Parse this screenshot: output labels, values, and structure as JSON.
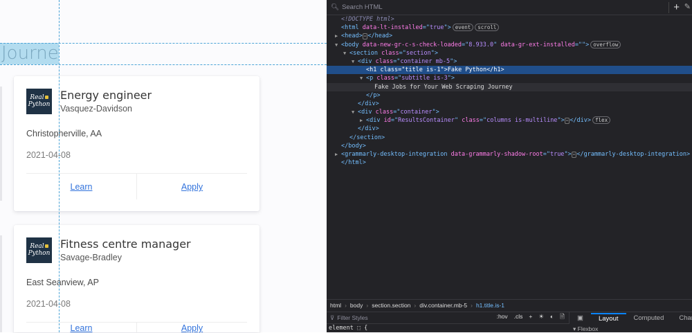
{
  "page": {
    "title_fragment": "Journey",
    "cards": [
      {
        "title": "Energy engineer",
        "company": "Vasquez-Davidson",
        "location": "Christopherville, AA",
        "date": "2021-04-08",
        "learn": "Learn",
        "apply": "Apply",
        "logo_text": "Real Python"
      },
      {
        "title": "Fitness centre manager",
        "company": "Savage-Bradley",
        "location": "East Seanview, AP",
        "date": "2021-04-08",
        "learn": "Learn",
        "apply": "Apply",
        "logo_text": "Real Python"
      }
    ]
  },
  "devtools": {
    "search_placeholder": "Search HTML",
    "lines": [
      {
        "ind": 1,
        "tw": "",
        "tokens": [
          {
            "t": "<!DOCTYPE html>",
            "c": "dt"
          }
        ]
      },
      {
        "ind": 1,
        "tw": "",
        "tokens": [
          {
            "t": "<html ",
            "c": "tg"
          },
          {
            "t": "data-lt-installed",
            "c": "at"
          },
          {
            "t": "=\"",
            "c": "tg"
          },
          {
            "t": "true",
            "c": "av"
          },
          {
            "t": "\">",
            "c": "tg"
          }
        ],
        "badges": [
          "event",
          "scroll"
        ]
      },
      {
        "ind": 1,
        "tw": "▶",
        "tokens": [
          {
            "t": "<head>",
            "c": "tg"
          },
          {
            "t": "⋯",
            "c": "dots"
          },
          {
            "t": "</head>",
            "c": "tg"
          }
        ]
      },
      {
        "ind": 1,
        "tw": "▼",
        "tokens": [
          {
            "t": "<body ",
            "c": "tg"
          },
          {
            "t": "data-new-gr-c-s-check-loaded",
            "c": "at"
          },
          {
            "t": "=\"",
            "c": "tg"
          },
          {
            "t": "8.933.0",
            "c": "av"
          },
          {
            "t": "\" ",
            "c": "tg"
          },
          {
            "t": "data-gr-ext-installed",
            "c": "at"
          },
          {
            "t": "=\"\">",
            "c": "tg"
          }
        ],
        "badges": [
          "overflow"
        ]
      },
      {
        "ind": 2,
        "tw": "▼",
        "tokens": [
          {
            "t": "<section ",
            "c": "tg"
          },
          {
            "t": "class",
            "c": "at"
          },
          {
            "t": "=\"",
            "c": "tg"
          },
          {
            "t": "section",
            "c": "av"
          },
          {
            "t": "\">",
            "c": "tg"
          }
        ]
      },
      {
        "ind": 3,
        "tw": "▼",
        "tokens": [
          {
            "t": "<div ",
            "c": "tg"
          },
          {
            "t": "class",
            "c": "at"
          },
          {
            "t": "=\"",
            "c": "tg"
          },
          {
            "t": "container mb-5",
            "c": "av"
          },
          {
            "t": "\">",
            "c": "tg"
          }
        ]
      },
      {
        "ind": 4,
        "tw": "",
        "sel": true,
        "tokens": [
          {
            "t": "<h1 ",
            "c": "tg"
          },
          {
            "t": "class",
            "c": "at"
          },
          {
            "t": "=\"",
            "c": "tg"
          },
          {
            "t": "title is-1",
            "c": "av"
          },
          {
            "t": "\">",
            "c": "tg"
          },
          {
            "t": "Fake Python",
            "c": "tx"
          },
          {
            "t": "</h1>",
            "c": "tg"
          }
        ]
      },
      {
        "ind": 4,
        "tw": "▼",
        "tokens": [
          {
            "t": "<p ",
            "c": "tg"
          },
          {
            "t": "class",
            "c": "at"
          },
          {
            "t": "=\"",
            "c": "tg"
          },
          {
            "t": "subtitle is-3",
            "c": "av"
          },
          {
            "t": "\">",
            "c": "tg"
          }
        ]
      },
      {
        "ind": 5,
        "tw": "",
        "hov": true,
        "tokens": [
          {
            "t": "Fake Jobs for Your Web Scraping Journey",
            "c": "tx"
          }
        ]
      },
      {
        "ind": 4,
        "tw": "",
        "tokens": [
          {
            "t": "</p>",
            "c": "tg"
          }
        ]
      },
      {
        "ind": 3,
        "tw": "",
        "tokens": [
          {
            "t": "</div>",
            "c": "tg"
          }
        ]
      },
      {
        "ind": 3,
        "tw": "▼",
        "tokens": [
          {
            "t": "<div ",
            "c": "tg"
          },
          {
            "t": "class",
            "c": "at"
          },
          {
            "t": "=\"",
            "c": "tg"
          },
          {
            "t": "container",
            "c": "av"
          },
          {
            "t": "\">",
            "c": "tg"
          }
        ]
      },
      {
        "ind": 4,
        "tw": "▶",
        "tokens": [
          {
            "t": "<div ",
            "c": "tg"
          },
          {
            "t": "id",
            "c": "at"
          },
          {
            "t": "=\"",
            "c": "tg"
          },
          {
            "t": "ResultsContainer",
            "c": "av"
          },
          {
            "t": "\" ",
            "c": "tg"
          },
          {
            "t": "class",
            "c": "at"
          },
          {
            "t": "=\"",
            "c": "tg"
          },
          {
            "t": "columns is-multiline",
            "c": "av"
          },
          {
            "t": "\">",
            "c": "tg"
          },
          {
            "t": "⋯",
            "c": "dots"
          },
          {
            "t": "</div>",
            "c": "tg"
          }
        ],
        "badges": [
          "flex"
        ]
      },
      {
        "ind": 3,
        "tw": "",
        "tokens": [
          {
            "t": "</div>",
            "c": "tg"
          }
        ]
      },
      {
        "ind": 2,
        "tw": "",
        "tokens": [
          {
            "t": "</section>",
            "c": "tg"
          }
        ]
      },
      {
        "ind": 1,
        "tw": "",
        "tokens": [
          {
            "t": "</body>",
            "c": "tg"
          }
        ]
      },
      {
        "ind": 1,
        "tw": "▶",
        "tokens": [
          {
            "t": "<grammarly-desktop-integration ",
            "c": "tg"
          },
          {
            "t": "data-grammarly-shadow-root",
            "c": "at"
          },
          {
            "t": "=\"",
            "c": "tg"
          },
          {
            "t": "true",
            "c": "av"
          },
          {
            "t": "\">",
            "c": "tg"
          },
          {
            "t": "⋯",
            "c": "dots"
          },
          {
            "t": "</grammarly-desktop-integration>",
            "c": "tg"
          }
        ]
      },
      {
        "ind": 1,
        "tw": "",
        "tokens": [
          {
            "t": "</html>",
            "c": "tg"
          }
        ]
      }
    ],
    "breadcrumb": [
      "html",
      "body",
      "section.section",
      "div.container.mb-5",
      "h1.title.is-1"
    ],
    "filter_placeholder": "Filter Styles",
    "style_tools": [
      ":hov",
      ".cls",
      "+",
      "☀",
      "◐",
      "🗎"
    ],
    "right_tabs": [
      "Layout",
      "Computed",
      "Changes"
    ],
    "element_rule": "element ⬚ {",
    "flexbox_label": "▾ Flexbox"
  }
}
